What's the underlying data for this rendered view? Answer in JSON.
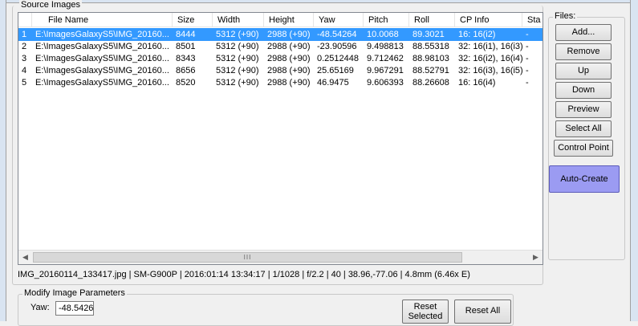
{
  "source_group": {
    "label": "Source Images"
  },
  "files_group": {
    "label": "Files:"
  },
  "columns": [
    "",
    "File Name",
    "Size",
    "Width",
    "Height",
    "Yaw",
    "Pitch",
    "Roll",
    "CP Info",
    "Sta"
  ],
  "rows": [
    {
      "num": "1",
      "file": "E:\\ImagesGalaxyS5\\IMG_20160...",
      "size": "8444",
      "width": "5312 (+90)",
      "height": "2988 (+90)",
      "yaw": "-48.54264",
      "pitch": "10.0068",
      "roll": "89.3021",
      "cp": "16: 16(i2)",
      "sta": "-",
      "selected": true
    },
    {
      "num": "2",
      "file": "E:\\ImagesGalaxyS5\\IMG_20160...",
      "size": "8501",
      "width": "5312 (+90)",
      "height": "2988 (+90)",
      "yaw": "-23.90596",
      "pitch": "9.498813",
      "roll": "88.55318",
      "cp": "32: 16(i1), 16(i3)",
      "sta": "-",
      "selected": false
    },
    {
      "num": "3",
      "file": "E:\\ImagesGalaxyS5\\IMG_20160...",
      "size": "8343",
      "width": "5312 (+90)",
      "height": "2988 (+90)",
      "yaw": "0.2512448",
      "pitch": "9.712462",
      "roll": "88.98103",
      "cp": "32: 16(i2), 16(i4)",
      "sta": "-",
      "selected": false
    },
    {
      "num": "4",
      "file": "E:\\ImagesGalaxyS5\\IMG_20160...",
      "size": "8656",
      "width": "5312 (+90)",
      "height": "2988 (+90)",
      "yaw": "25.65169",
      "pitch": "9.967291",
      "roll": "88.52791",
      "cp": "32: 16(i3), 16(i5)",
      "sta": "-",
      "selected": false
    },
    {
      "num": "5",
      "file": "E:\\ImagesGalaxyS5\\IMG_20160...",
      "size": "8520",
      "width": "5312 (+90)",
      "height": "2988 (+90)",
      "yaw": "46.9475",
      "pitch": "9.606393",
      "roll": "88.26608",
      "cp": "16: 16(i4)",
      "sta": "-",
      "selected": false
    }
  ],
  "scrollbar": {
    "thumb_grip": "III"
  },
  "buttons": {
    "add": "Add...",
    "remove": "Remove",
    "up": "Up",
    "down": "Down",
    "preview": "Preview",
    "select_all": "Select All",
    "control_point": "Control Point",
    "auto_create": "Auto-Create",
    "reset_selected_1": "Reset",
    "reset_selected_2": "Selected",
    "reset_all": "Reset All"
  },
  "status_line": "IMG_20160114_133417.jpg  |  SM-G900P  |  2016:01:14 13:34:17  |  1/1028  |  f/2.2  |  40  |  38.96,-77.06  |  4.8mm (6.46x E)",
  "modify_group": {
    "label": "Modify Image Parameters"
  },
  "yaw_field": {
    "label": "Yaw:",
    "value": "-48.5426"
  },
  "colors": {
    "selection": "#3399ff",
    "auto_create": "#9b9bf2"
  }
}
